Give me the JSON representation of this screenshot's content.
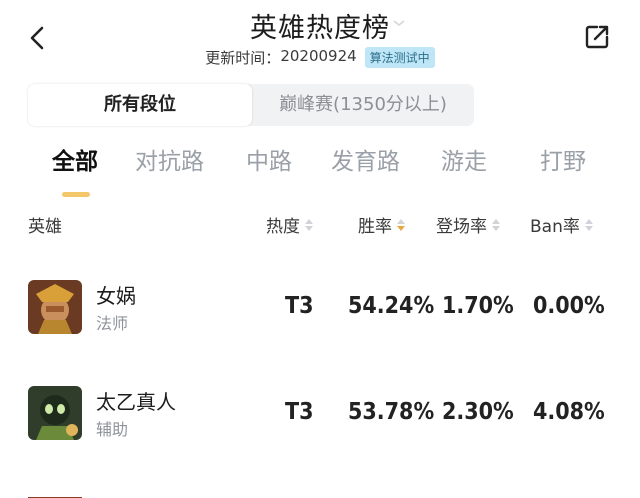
{
  "header": {
    "title": "英雄热度榜",
    "updated_label": "更新时间：",
    "updated_value": "20200924",
    "algo_badge": "算法测试中"
  },
  "segment": {
    "active": "所有段位",
    "other": "巅峰赛(1350分以上)"
  },
  "tabs": [
    "全部",
    "对抗路",
    "中路",
    "发育路",
    "游走",
    "打野"
  ],
  "active_tab_index": 0,
  "columns": {
    "hero": "英雄",
    "heat": "热度",
    "win": "胜率",
    "pick": "登场率",
    "ban": "Ban率"
  },
  "active_sort": "win",
  "rows": [
    {
      "name": "女娲",
      "role": "法师",
      "heat": "T3",
      "win": "54.24%",
      "pick": "1.70%",
      "ban": "0.00%",
      "avatar_icon": "nuwa-avatar-icon"
    },
    {
      "name": "太乙真人",
      "role": "辅助",
      "heat": "T3",
      "win": "53.78%",
      "pick": "2.30%",
      "ban": "4.08%",
      "avatar_icon": "taiyi-avatar-icon"
    }
  ],
  "colors": {
    "accent_underline": "#f3c76a",
    "sort_active": "#e8a842",
    "badge_bg": "#bfe6f6"
  }
}
